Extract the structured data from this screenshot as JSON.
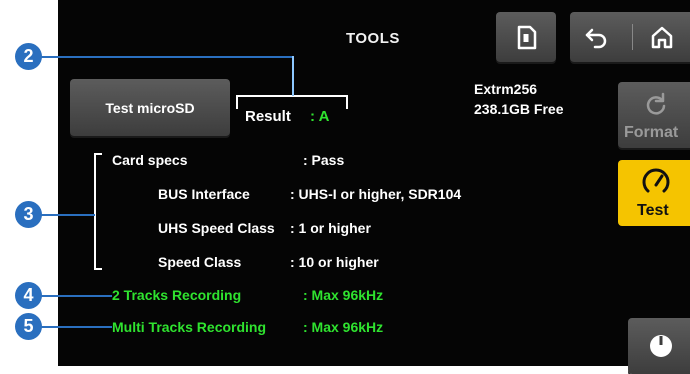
{
  "header": {
    "title": "TOOLS"
  },
  "test_button": {
    "label": "Test microSD"
  },
  "result": {
    "label": "Result",
    "value": ": A"
  },
  "card": {
    "name": "Extrm256",
    "free": "238.1GB Free"
  },
  "format_button": {
    "label": "Format"
  },
  "test_tab": {
    "label": "Test"
  },
  "specs": {
    "card_specs": {
      "label": "Card specs",
      "value": ": Pass"
    },
    "bus": {
      "label": "BUS Interface",
      "value": ": UHS-I or higher,  SDR104"
    },
    "uhs": {
      "label": "UHS Speed Class",
      "value": ": 1 or higher"
    },
    "speed": {
      "label": "Speed Class",
      "value": ": 10 or higher"
    },
    "two_tracks": {
      "label": "2 Tracks Recording",
      "value": ": Max 96kHz"
    },
    "multi_tracks": {
      "label": "Multi Tracks Recording",
      "value": ": Max 96kHz"
    }
  },
  "callouts": [
    "2",
    "3",
    "4",
    "5"
  ],
  "colors": {
    "accent_green": "#2fe32f",
    "test_yellow": "#f5c400",
    "callout_blue": "#2a6fbf"
  }
}
